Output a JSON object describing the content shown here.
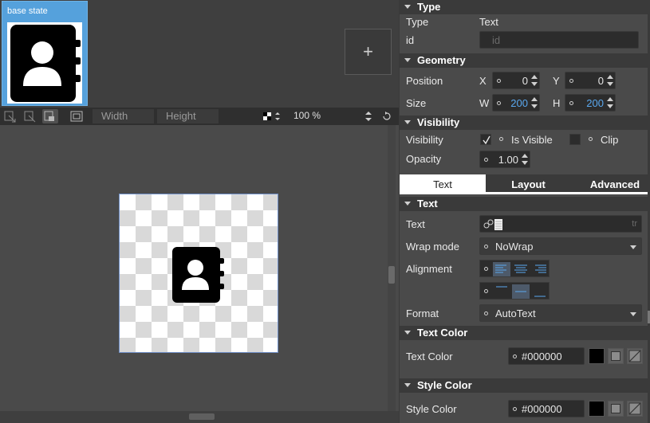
{
  "states": {
    "base_state_label": "base state",
    "add_label": "+"
  },
  "toolbar": {
    "width_placeholder": "Width",
    "height_placeholder": "Height",
    "zoom": "100 %"
  },
  "panel": {
    "type_section": {
      "title": "Type",
      "type_label": "Type",
      "type_value": "Text",
      "id_label": "id",
      "id_placeholder": "id"
    },
    "geometry_section": {
      "title": "Geometry",
      "position_label": "Position",
      "x_label": "X",
      "x_value": "0",
      "y_label": "Y",
      "y_value": "0",
      "size_label": "Size",
      "w_label": "W",
      "w_value": "200",
      "h_label": "H",
      "h_value": "200"
    },
    "visibility_section": {
      "title": "Visibility",
      "visibility_label": "Visibility",
      "is_visible_label": "Is Visible",
      "is_visible_checked": true,
      "clip_label": "Clip",
      "clip_checked": false,
      "opacity_label": "Opacity",
      "opacity_value": "1.00"
    },
    "tabs": [
      {
        "label": "Text",
        "active": true
      },
      {
        "label": "Layout",
        "active": false
      },
      {
        "label": "Advanced",
        "active": false
      }
    ],
    "text_section": {
      "title": "Text",
      "text_label": "Text",
      "tr_label": "tr",
      "wrap_label": "Wrap mode",
      "wrap_value": "NoWrap",
      "alignment_label": "Alignment",
      "format_label": "Format",
      "format_value": "AutoText"
    },
    "text_color_section": {
      "title": "Text Color",
      "label": "Text Color",
      "value": "#000000"
    },
    "style_color_section": {
      "title": "Style Color",
      "label": "Style Color",
      "value": "#000000"
    }
  },
  "colors": {
    "selection_blue": "#55a1dc",
    "value_blue": "#5aa8ef",
    "text_color_swatch": "#000000"
  },
  "icons": {
    "state_thumbnail": "contact-book-icon",
    "canvas_item": "contact-book-icon"
  }
}
